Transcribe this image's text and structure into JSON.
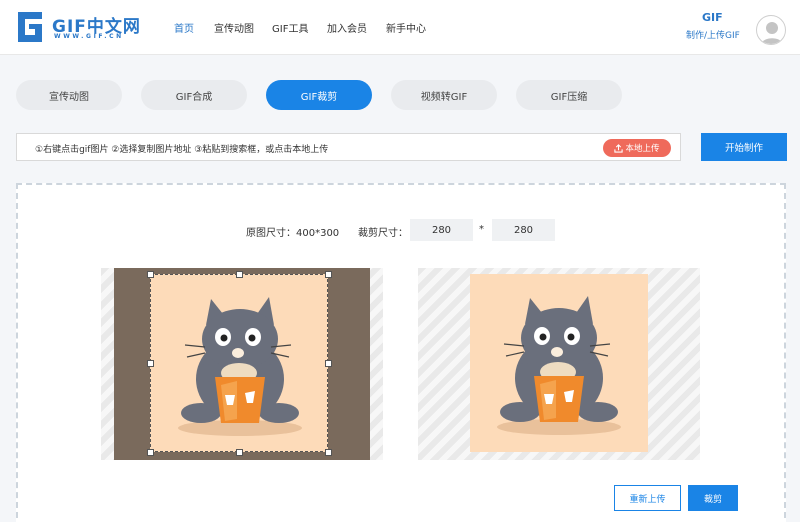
{
  "logo": {
    "text": "GIF中文网",
    "sub": "WWW.GIF.CN"
  },
  "nav": [
    {
      "label": "首页",
      "active": true
    },
    {
      "label": "宣传动图",
      "active": false
    },
    {
      "label": "GIF工具",
      "active": false
    },
    {
      "label": "加入会员",
      "active": false
    },
    {
      "label": "新手中心",
      "active": false
    }
  ],
  "header_right": {
    "badge": "GIF",
    "link": "制作/上传GIF"
  },
  "tabs": [
    {
      "label": "宣传动图",
      "active": false
    },
    {
      "label": "GIF合成",
      "active": false
    },
    {
      "label": "GIF裁剪",
      "active": true
    },
    {
      "label": "视频转GIF",
      "active": false
    },
    {
      "label": "GIF压缩",
      "active": false
    }
  ],
  "upload": {
    "hint": "①右键点击gif图片 ②选择复制图片地址 ③粘贴到搜索框，或点击本地上传",
    "local_button": "本地上传"
  },
  "start_button": "开始制作",
  "size": {
    "original_label": "原图尺寸：400*300",
    "crop_label": "裁剪尺寸：",
    "width": "280",
    "height": "280",
    "times": "*"
  },
  "actions": {
    "reupload": "重新上传",
    "crop": "裁剪"
  },
  "colors": {
    "accent": "#1a84e6",
    "upload": "#ef6a5b",
    "image_bg": "#fddbb9",
    "dark_bg": "#7a6a5c"
  }
}
